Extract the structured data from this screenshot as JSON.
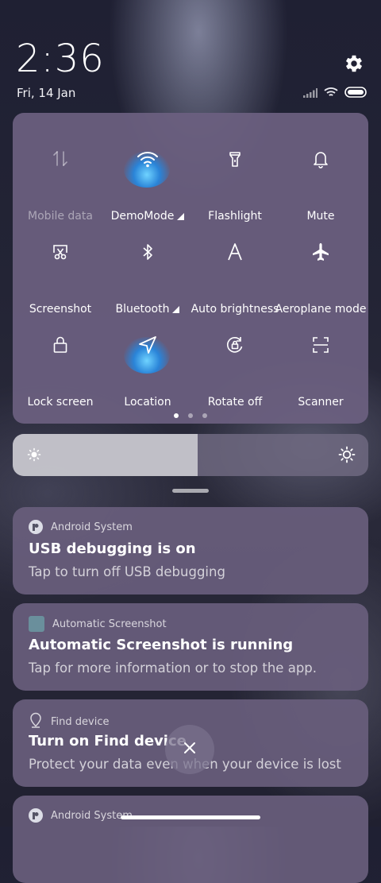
{
  "status": {
    "time": "2:36",
    "date": "Fri, 14 Jan",
    "icons": [
      "signal-icon",
      "wifi-icon",
      "battery-icon"
    ]
  },
  "quick_settings": {
    "tiles": [
      {
        "label": "Mobile data",
        "icon": "mobile-data-icon",
        "active": false,
        "disabled": true,
        "has_arrow": false
      },
      {
        "label": "DemoMode",
        "icon": "wifi-icon",
        "active": true,
        "disabled": false,
        "has_arrow": true
      },
      {
        "label": "Flashlight",
        "icon": "flashlight-icon",
        "active": false,
        "disabled": false,
        "has_arrow": false
      },
      {
        "label": "Mute",
        "icon": "bell-icon",
        "active": false,
        "disabled": false,
        "has_arrow": false
      },
      {
        "label": "Screenshot",
        "icon": "screenshot-icon",
        "active": false,
        "disabled": false,
        "has_arrow": false
      },
      {
        "label": "Bluetooth",
        "icon": "bluetooth-icon",
        "active": false,
        "disabled": false,
        "has_arrow": true
      },
      {
        "label": "Auto brightness",
        "icon": "auto-brightness-icon",
        "active": false,
        "disabled": false,
        "has_arrow": false
      },
      {
        "label": "Aeroplane mode",
        "icon": "airplane-icon",
        "active": false,
        "disabled": false,
        "has_arrow": false
      },
      {
        "label": "Lock screen",
        "icon": "lock-icon",
        "active": false,
        "disabled": false,
        "has_arrow": false
      },
      {
        "label": "Location",
        "icon": "location-icon",
        "active": true,
        "disabled": false,
        "has_arrow": false
      },
      {
        "label": "Rotate off",
        "icon": "rotate-lock-icon",
        "active": false,
        "disabled": false,
        "has_arrow": false
      },
      {
        "label": "Scanner",
        "icon": "scanner-icon",
        "active": false,
        "disabled": false,
        "has_arrow": false
      }
    ],
    "page_count": 3,
    "current_page": 1
  },
  "brightness": {
    "level": 0.52
  },
  "notifications": [
    {
      "app": "Android System",
      "app_icon": "android-system-icon",
      "title": "USB debugging is on",
      "body": "Tap to turn off USB debugging"
    },
    {
      "app": "Automatic Screenshot",
      "app_icon": "automatic-screenshot-icon",
      "title": "Automatic Screenshot is running",
      "body": "Tap for more information or to stop the app."
    },
    {
      "app": "Find device",
      "app_icon": "find-device-icon",
      "title": "Turn on Find device",
      "body": "Protect your data even when your device is lost"
    },
    {
      "app": "Android System",
      "app_icon": "android-system-icon",
      "title": "",
      "body": ""
    }
  ],
  "colors": {
    "panel": "#6c6080",
    "active_glow": "#2a84d8"
  }
}
